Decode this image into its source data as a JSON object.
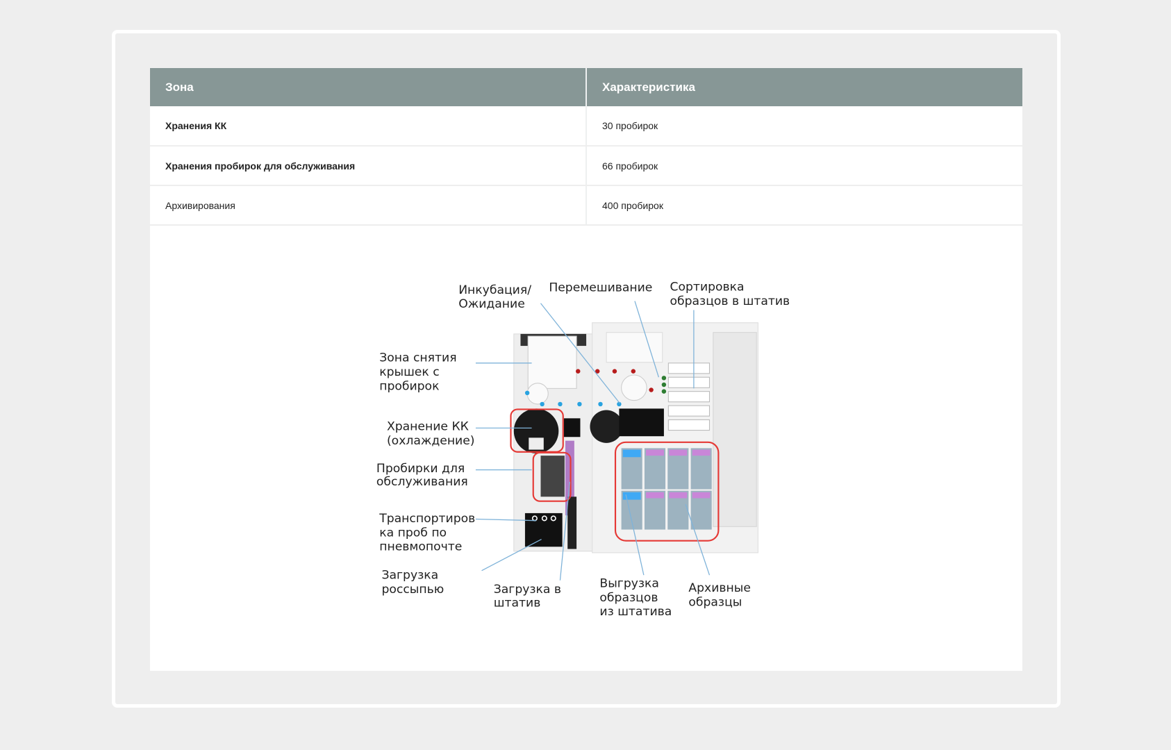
{
  "table": {
    "headers": [
      "Зона",
      "Характеристика"
    ],
    "rows": [
      {
        "zone": "Хранения КК",
        "value": "30 пробирок"
      },
      {
        "zone": "Хранения пробирок для обслуживания",
        "value": "66 пробирок"
      },
      {
        "zone": "Архивирования",
        "value": "400 пробирок"
      }
    ]
  },
  "diagram": {
    "labels": {
      "incubation": [
        "Инкубация/",
        "Ожидание"
      ],
      "mixing": [
        "Перемешивание"
      ],
      "sorting": [
        "Сортировка",
        "образцов в штатив"
      ],
      "decap": [
        "Зона снятия",
        "крышек с",
        "пробирок"
      ],
      "qc_storage": [
        "Хранение КК",
        "(охлаждение)"
      ],
      "service_tubes": [
        "Пробирки для",
        "обслуживания"
      ],
      "pneumatic": [
        "Транспортиров",
        "ка проб по",
        "пневмопочте"
      ],
      "bulk_load": [
        "Загрузка",
        "россыпью"
      ],
      "rack_load": [
        "Загрузка в",
        "штатив"
      ],
      "unload": [
        "Выгрузка",
        "образцов",
        "из штатива"
      ],
      "archive": [
        "Архивные",
        "образцы"
      ]
    },
    "colors": {
      "frame": "#e53935",
      "leader": "#7fb3d9",
      "header": "#879796"
    }
  }
}
